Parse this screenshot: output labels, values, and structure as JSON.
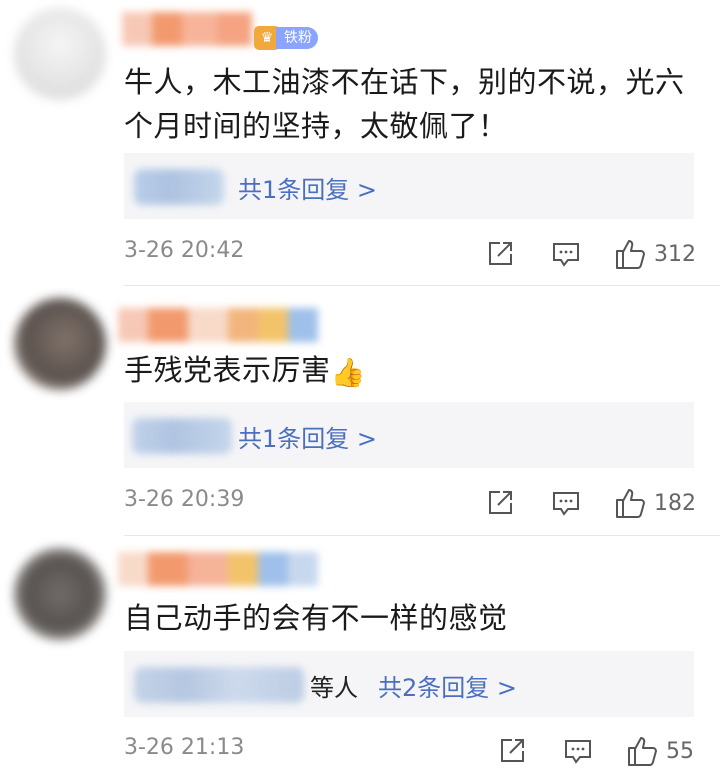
{
  "comments": [
    {
      "badge": "铁粉",
      "text": "牛人，木工油漆不在话下，别的不说，光六个月时间的坚持，太敬佩了！",
      "reply_link": "共1条回复 >",
      "reply_prefix": "",
      "time": "3-26 20:42",
      "likes": "312"
    },
    {
      "badge": "",
      "text": "手残党表示厉害",
      "emoji": "👍",
      "reply_link": "共1条回复 >",
      "reply_prefix": "",
      "time": "3-26 20:39",
      "likes": "182"
    },
    {
      "badge": "",
      "text": "自己动手的会有不一样的感觉",
      "reply_link": "共2条回复 >",
      "reply_prefix": "等人",
      "time": "3-26 21:13",
      "likes": "55"
    }
  ],
  "icons": {
    "share": "share-icon",
    "comment": "comment-icon",
    "like": "thumbs-up-icon",
    "badge": "crown-icon"
  },
  "colors": {
    "link": "#4a6fbf",
    "meta": "#8a8a8a",
    "reply_bg": "#f5f5f7",
    "badge_crown": "#f2a93b",
    "badge_tag": "#8aa4ff"
  }
}
